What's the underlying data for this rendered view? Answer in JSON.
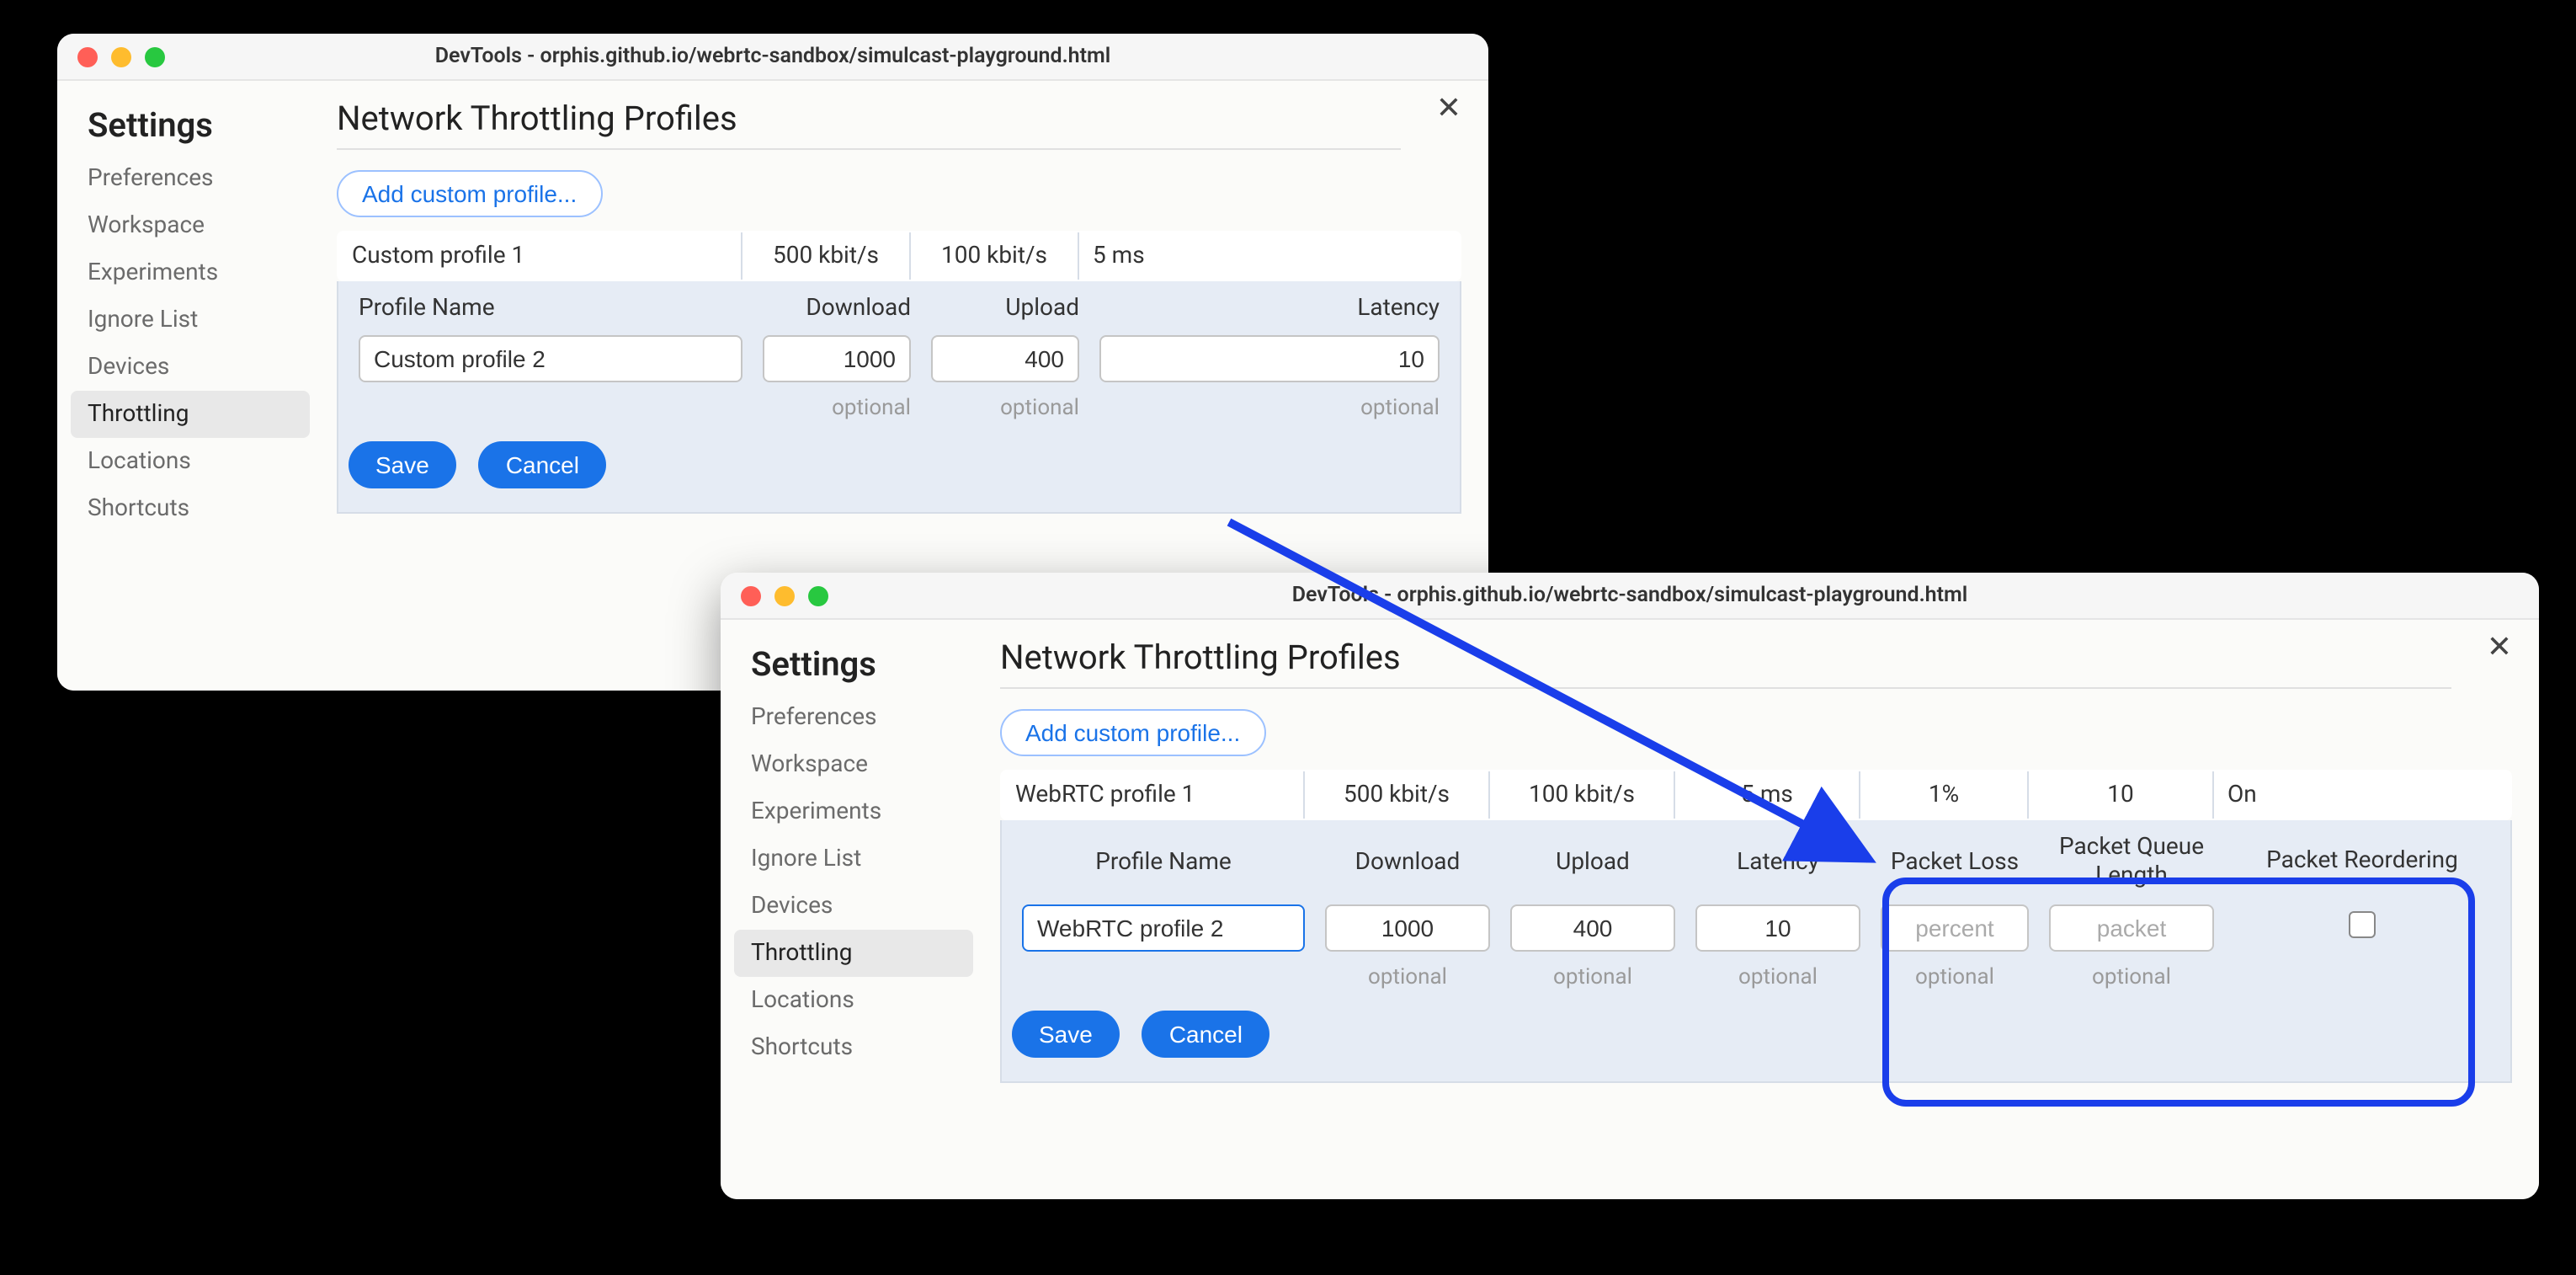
{
  "windowA": {
    "title": "DevTools - orphis.github.io/webrtc-sandbox/simulcast-playground.html",
    "sidebar": {
      "title": "Settings",
      "items": [
        "Preferences",
        "Workspace",
        "Experiments",
        "Ignore List",
        "Devices",
        "Throttling",
        "Locations",
        "Shortcuts"
      ],
      "selected": "Throttling"
    },
    "main": {
      "title": "Network Throttling Profiles",
      "addProfile": "Add custom profile...",
      "existingRow": {
        "name": "Custom profile 1",
        "download": "500 kbit/s",
        "upload": "100 kbit/s",
        "latency": "5 ms"
      },
      "headers": [
        "Profile Name",
        "Download",
        "Upload",
        "Latency"
      ],
      "edit": {
        "name": "Custom profile 2",
        "download": "1000",
        "upload": "400",
        "latency": "10",
        "optional": "optional"
      },
      "buttons": {
        "save": "Save",
        "cancel": "Cancel"
      }
    }
  },
  "windowB": {
    "title": "DevTools - orphis.github.io/webrtc-sandbox/simulcast-playground.html",
    "sidebar": {
      "title": "Settings",
      "items": [
        "Preferences",
        "Workspace",
        "Experiments",
        "Ignore List",
        "Devices",
        "Throttling",
        "Locations",
        "Shortcuts"
      ],
      "selected": "Throttling"
    },
    "main": {
      "title": "Network Throttling Profiles",
      "addProfile": "Add custom profile...",
      "existingRow": {
        "name": "WebRTC profile 1",
        "download": "500 kbit/s",
        "upload": "100 kbit/s",
        "latency": "5 ms",
        "packetLoss": "1%",
        "queue": "10",
        "reorder": "On"
      },
      "headers": [
        "Profile Name",
        "Download",
        "Upload",
        "Latency",
        "Packet Loss",
        "Packet Queue Length",
        "Packet Reordering"
      ],
      "edit": {
        "name": "WebRTC profile 2",
        "download": "1000",
        "upload": "400",
        "latency": "10",
        "packetLossPlaceholder": "percent",
        "queuePlaceholder": "packet",
        "optional": "optional"
      },
      "buttons": {
        "save": "Save",
        "cancel": "Cancel"
      }
    }
  }
}
